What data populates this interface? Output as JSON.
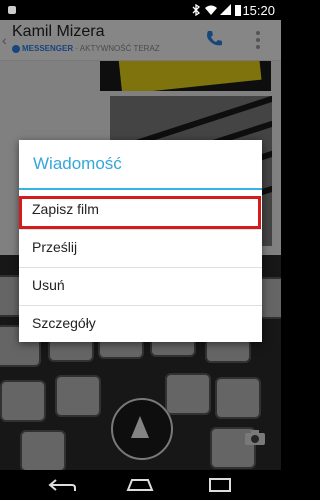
{
  "status_bar": {
    "time": "15:20"
  },
  "header": {
    "contact_name": "Kamil Mizera",
    "messenger_label": "MESSENGER",
    "activity_text": "· AKTYWNOŚĆ TERAZ"
  },
  "dialog": {
    "title": "Wiadomość",
    "items": [
      {
        "label": "Zapisz film"
      },
      {
        "label": "Prześlij"
      },
      {
        "label": "Usuń"
      },
      {
        "label": "Szczegóły"
      }
    ]
  },
  "colors": {
    "accent": "#35a7d8",
    "highlight_border": "#d31d1d",
    "messenger_blue": "#2f7ee3"
  },
  "icons": [
    "back-icon",
    "phone-icon",
    "overflow-menu-icon",
    "shutter-icon",
    "camera-switch-icon",
    "nav-back-icon",
    "nav-home-icon",
    "nav-recents-icon"
  ]
}
